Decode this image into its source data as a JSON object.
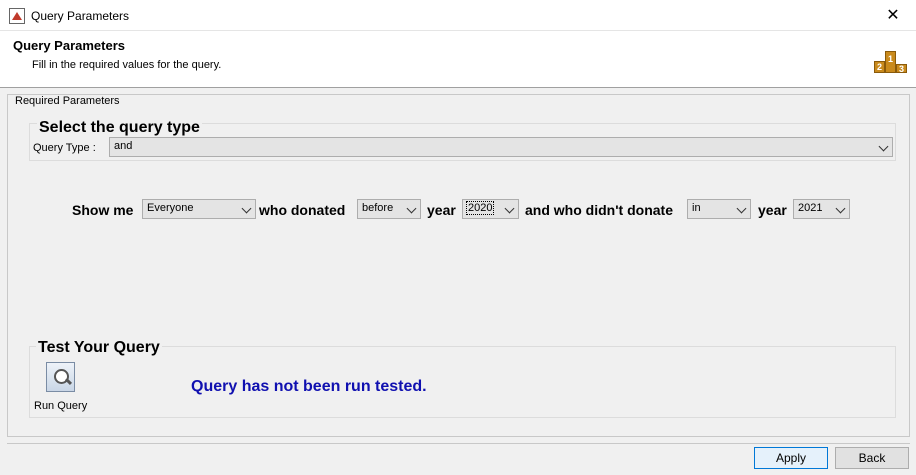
{
  "window": {
    "title": "Query Parameters",
    "close_symbol": "✕"
  },
  "header": {
    "title": "Query Parameters",
    "subtitle": "Fill in the required values for the query.",
    "podium": [
      "2",
      "1",
      "3"
    ]
  },
  "group": {
    "legend": "Required Parameters"
  },
  "query_type": {
    "heading": "Select the query type",
    "label": "Query Type :",
    "value": "and"
  },
  "sentence": {
    "show_me": "Show me",
    "who_value": "Everyone",
    "who_donated": "who donated",
    "time1": "before",
    "year_label1": "year",
    "year1": "2020",
    "didnt_donate": "and who didn't donate",
    "time2": "in",
    "year_label2": "year",
    "year2": "2021"
  },
  "test": {
    "heading": "Test Your Query",
    "run_label": "Run Query",
    "status": "Query has not been run tested."
  },
  "buttons": {
    "apply": "Apply",
    "back": "Back"
  }
}
